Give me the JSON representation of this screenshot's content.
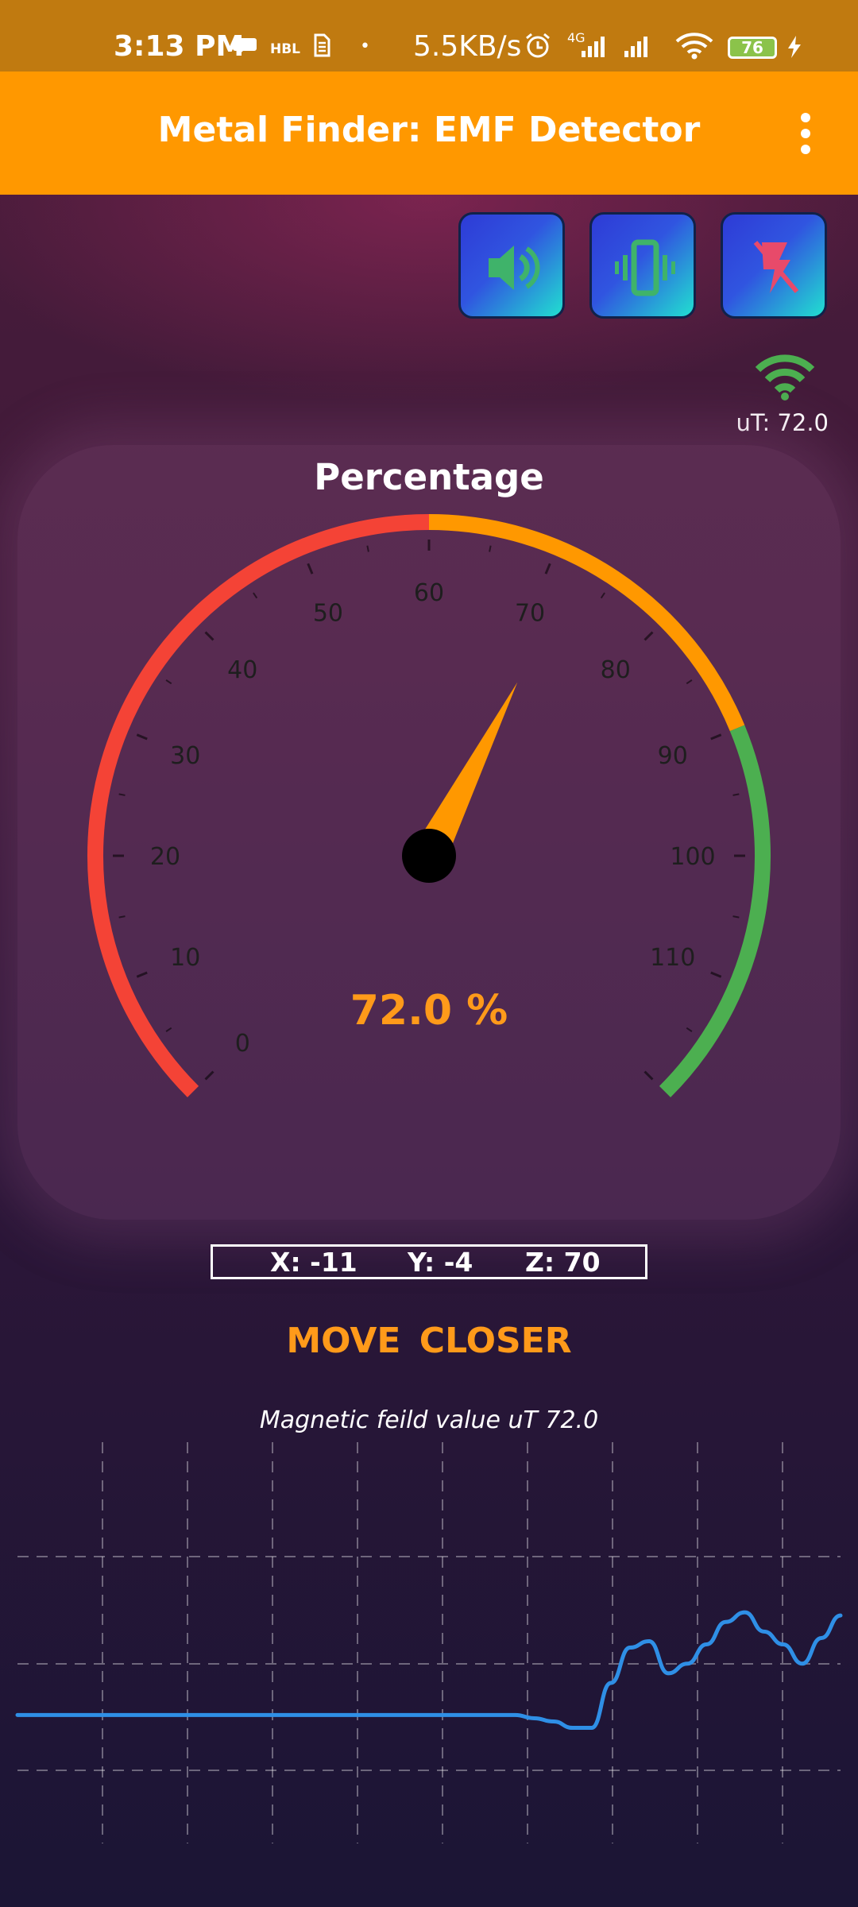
{
  "status_bar": {
    "time": "3:13 PM",
    "carrier_tag": "HBL",
    "net_speed": "5.5KB/s",
    "network_type": "4G",
    "battery": "76",
    "icons": [
      "chat-bubble-icon",
      "sim-icon",
      "alarm-icon",
      "signal-icon",
      "wifi-icon",
      "charging-icon"
    ]
  },
  "app_bar": {
    "title": "Metal Finder: EMF Detector",
    "menu_icon": "more-vert-icon"
  },
  "toolbar": {
    "buttons": [
      {
        "name": "sound-toggle",
        "icon": "volume-icon"
      },
      {
        "name": "vibrate-toggle",
        "icon": "vibrate-icon"
      },
      {
        "name": "flash-toggle",
        "icon": "flash-off-icon"
      }
    ],
    "button_gradient": [
      "#2e3bd6",
      "#21e0d0"
    ]
  },
  "signal": {
    "icon": "wifi-signal-icon",
    "ut_text": "uT: 72.0"
  },
  "gauge": {
    "title": "Percentage",
    "value": 72,
    "min": 0,
    "max": 120,
    "ticks": [
      "0",
      "10",
      "20",
      "30",
      "40",
      "50",
      "60",
      "70",
      "80",
      "90",
      "100",
      "110"
    ],
    "readout": "72.0 %",
    "zones": [
      {
        "from": 0,
        "to": 60,
        "color": "#f44336"
      },
      {
        "from": 60,
        "to": 90,
        "color": "#ff9800"
      },
      {
        "from": 90,
        "to": 120,
        "color": "#4caf50"
      }
    ],
    "needle_color": "#ff9800"
  },
  "axes": {
    "x": "X: -11",
    "y": "Y: -4",
    "z": "Z: 70"
  },
  "status_message": "MOVE  CLOSER",
  "field_label": "Magnetic feild value uT 72.0",
  "chart_data": {
    "type": "line",
    "title": "",
    "xlabel": "",
    "ylabel": "",
    "grid": true,
    "line_color": "#2f8fe6",
    "series": [
      {
        "values": [
          40,
          40,
          40,
          40,
          40,
          40,
          40,
          40,
          40,
          40,
          40,
          40,
          40,
          40,
          40,
          40,
          40,
          40,
          40,
          40,
          40,
          40,
          40,
          40,
          40,
          40,
          40,
          39,
          38,
          36,
          36,
          50,
          61,
          63,
          53,
          56,
          62,
          69,
          72,
          66,
          62,
          56,
          64,
          71
        ]
      }
    ],
    "ylim": [
      0,
      125
    ]
  }
}
